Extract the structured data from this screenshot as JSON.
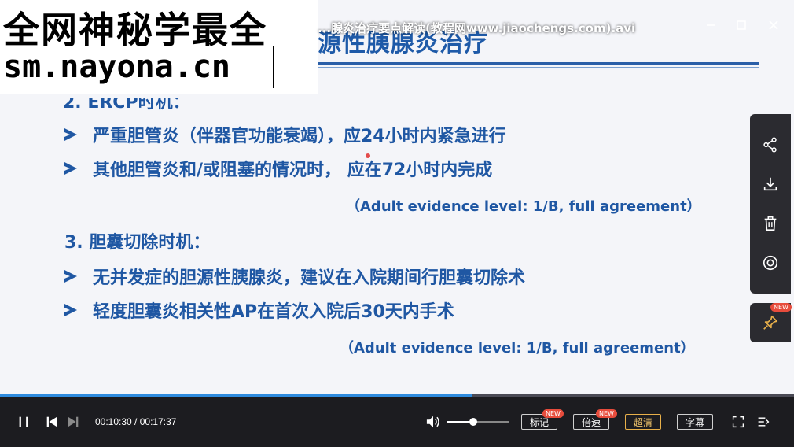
{
  "window": {
    "file_name": "...腺炎治疗要点解读(教程网www.jiaochengs.com).avi",
    "minimize_icon": "minimize-icon",
    "maximize_icon": "maximize-icon",
    "close_icon": "close-icon"
  },
  "watermark": {
    "line1": "全网神秘学最全",
    "line2": "sm.nayona.cn"
  },
  "slide": {
    "title": "源性胰腺炎治疗",
    "partial_section": "2. ERCP时机：",
    "bullets_1": [
      "严重胆管炎（伴器官功能衰竭），应24小时内紧急进行",
      "其他胆管炎和/或阻塞的情况时， 应在72小时内完成"
    ],
    "evidence_1": "（Adult evidence level: 1/B, full agreement）",
    "section_3": "3. 胆囊切除时机：",
    "bullets_2": [
      "无并发症的胆源性胰腺炎，建议在入院期间行胆囊切除术",
      "轻度胆囊炎相关性AP在首次入院后30天内手术"
    ],
    "evidence_2": "（Adult evidence level: 1/B, full agreement）"
  },
  "sidebar": {
    "icons": [
      "share-icon",
      "download-icon",
      "delete-icon",
      "screenshot-icon"
    ],
    "pin_icon": "pin-icon",
    "pin_badge": "NEW"
  },
  "player": {
    "progress_fraction": 0.595,
    "time_current": "00:10:30",
    "time_total": "00:17:37",
    "time_separator": " / ",
    "volume_fraction": 0.42,
    "buttons": {
      "mark": "标记",
      "speed": "倍速",
      "quality": "超清",
      "subtitle": "字幕"
    },
    "badges": {
      "mark": "NEW",
      "speed": "NEW"
    },
    "colors": {
      "accent": "#2e8bde",
      "quality_active": "#e8b04a",
      "badge": "#e74c3c"
    }
  }
}
